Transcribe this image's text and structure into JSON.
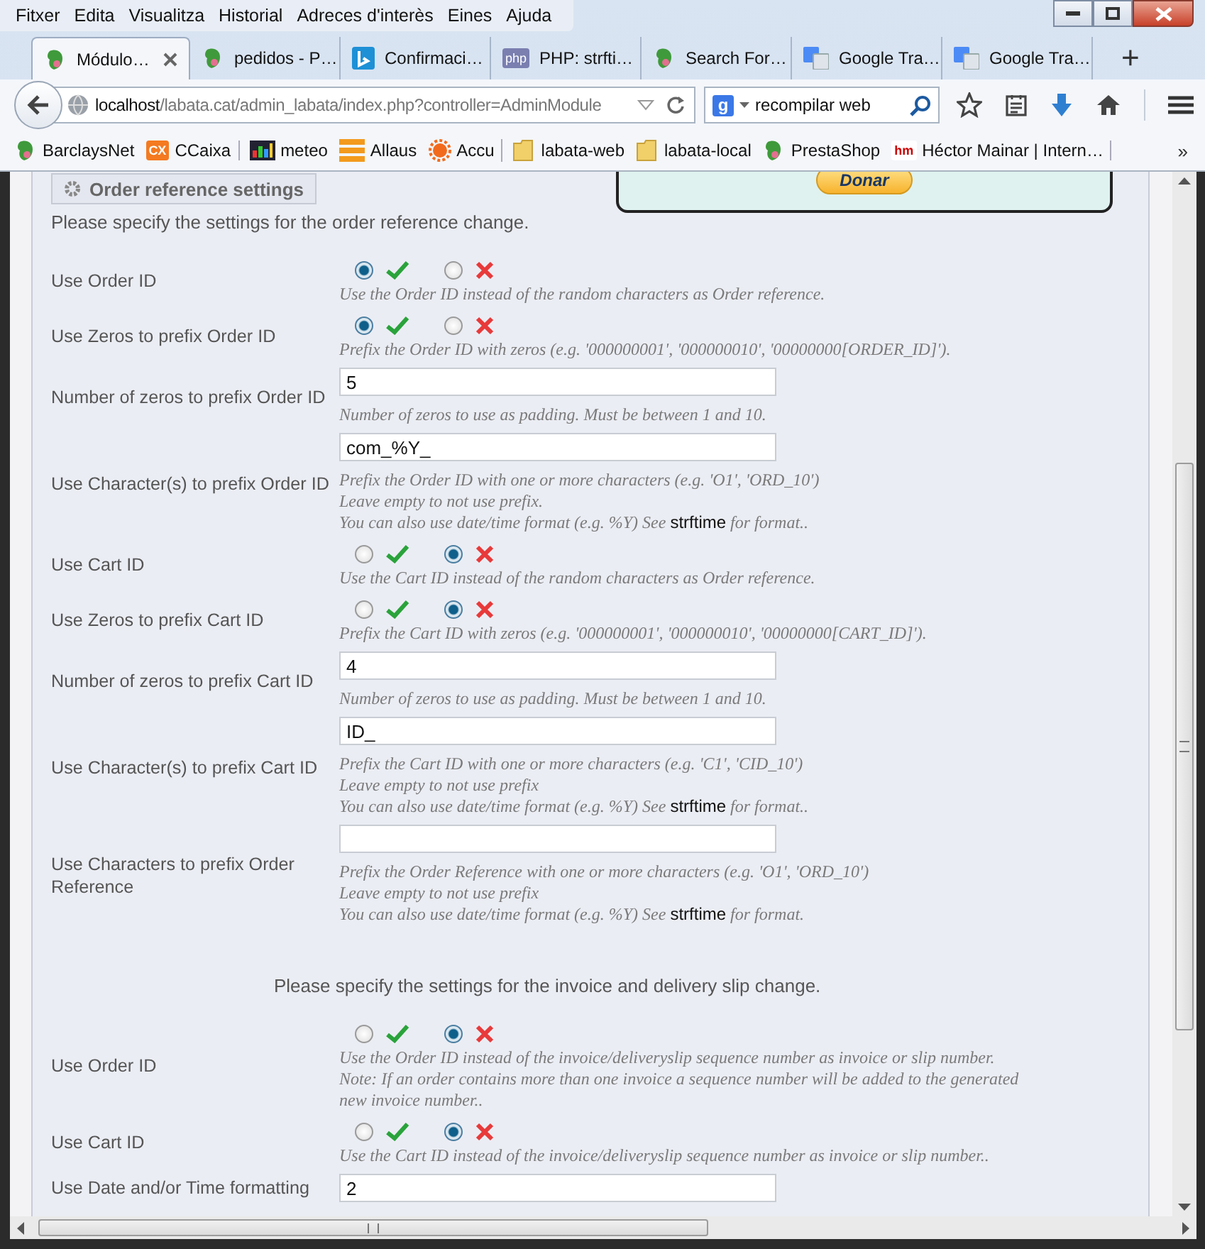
{
  "window": {
    "menu": [
      "Fitxer",
      "Edita",
      "Visualitza",
      "Historial",
      "Adreces d'interès",
      "Eines",
      "Ajuda"
    ]
  },
  "tabs": [
    {
      "title": "Módulo…",
      "kind": "bird",
      "selected": true
    },
    {
      "title": "pedidos - P…",
      "kind": "bird",
      "selected": false
    },
    {
      "title": "Confirmaci…",
      "kind": "square",
      "selected": false
    },
    {
      "title": "PHP: strfti…",
      "kind": "badge",
      "badge": "php",
      "selected": false
    },
    {
      "title": "Search For…",
      "kind": "bird",
      "selected": false
    },
    {
      "title": "Google Tra…",
      "kind": "translate",
      "selected": false
    },
    {
      "title": "Google Tra…",
      "kind": "translate",
      "selected": false
    }
  ],
  "new_tab": "+",
  "address_bar": {
    "host": "localhost",
    "path": "/labata.cat/admin_labata/index.php?controller=AdminModule"
  },
  "search": {
    "engine_badge": "g",
    "value": "recompilar web"
  },
  "bookmarks": [
    {
      "label": "BarclaysNet",
      "kind": "bird",
      "separator_after": false
    },
    {
      "label": "CCaixa",
      "kind": "badge",
      "badge": "CX",
      "separator_after": true
    },
    {
      "label": "meteo",
      "kind": "chart",
      "separator_after": false
    },
    {
      "label": "Allaus",
      "kind": "stripes",
      "separator_after": false
    },
    {
      "label": "Accu",
      "kind": "sun",
      "separator_after": true
    },
    {
      "label": "labata-web",
      "kind": "folder",
      "separator_after": false
    },
    {
      "label": "labata-local",
      "kind": "folder",
      "separator_after": false
    },
    {
      "label": "PrestaShop",
      "kind": "bird",
      "separator_after": false
    },
    {
      "label": "Héctor Mainar | Intern…",
      "kind": "badge",
      "badge": "hm",
      "separator_after": true
    }
  ],
  "bookmarks_overflow": "»",
  "donate": {
    "button": "Donar"
  },
  "section_1": {
    "legend": "Order reference settings",
    "intro": "Please specify the settings for the order reference change.",
    "rows": [
      {
        "label": "Use Order ID",
        "kind": "toggle",
        "enabled": true,
        "help": [
          "Use the Order ID instead of the random characters as Order reference."
        ]
      },
      {
        "label": "Use Zeros to prefix Order ID",
        "kind": "toggle",
        "enabled": true,
        "help": [
          "Prefix the Order ID with zeros (e.g. '000000001', '000000010', '00000000[ORDER_ID]')."
        ]
      },
      {
        "label": "Number of zeros to prefix Order ID",
        "kind": "text",
        "value": "5",
        "help": [
          "Number of zeros to use as padding. Must be between 1 and 10."
        ]
      },
      {
        "label": "Use Character(s) to prefix Order ID",
        "kind": "text",
        "value": "com_%Y_",
        "help": [
          "Prefix the Order ID with one or more characters (e.g. 'O1', 'ORD_10')",
          "Leave empty to not use prefix.",
          {
            "text": "You can also use date/time format (e.g. %Y) See ",
            "link": "strftime",
            "after": " for format.."
          }
        ]
      },
      {
        "label": "Use Cart ID",
        "kind": "toggle",
        "enabled": false,
        "help": [
          "Use the Cart ID instead of the random characters as Order reference."
        ]
      },
      {
        "label": "Use Zeros to prefix Cart ID",
        "kind": "toggle",
        "enabled": false,
        "help": [
          "Prefix the Cart ID with zeros (e.g. '000000001', '000000010', '00000000[CART_ID]')."
        ]
      },
      {
        "label": "Number of zeros to prefix Cart ID",
        "kind": "text",
        "value": "4",
        "help": [
          "Number of zeros to use as padding. Must be between 1 and 10."
        ]
      },
      {
        "label": "Use Character(s) to prefix Cart ID",
        "kind": "text",
        "value": "ID_",
        "help": [
          "Prefix the Cart ID with one or more characters (e.g. 'C1', 'CID_10')",
          "Leave empty to not use prefix",
          {
            "text": "You can also use date/time format (e.g. %Y) See ",
            "link": "strftime",
            "after": " for format.."
          }
        ]
      },
      {
        "label": "Use Characters to prefix Order Reference",
        "kind": "text",
        "value": "",
        "help": [
          "Prefix the Order Reference with one or more characters (e.g. 'O1', 'ORD_10')",
          "Leave empty to not use prefix",
          {
            "text": "You can also use date/time format (e.g. %Y) See ",
            "link": "strftime",
            "after": " for format."
          }
        ]
      }
    ]
  },
  "section_2": {
    "intro": "Please specify the settings for the invoice and delivery slip change.",
    "rows": [
      {
        "label": "Use Order ID",
        "kind": "toggle",
        "enabled": false,
        "help": [
          "Use the Order ID instead of the invoice/deliveryslip sequence number as invoice or slip number.",
          "Note: If an order contains more than one invoice a sequence number will be added to the generated new invoice number.."
        ]
      },
      {
        "label": "Use Cart ID",
        "kind": "toggle",
        "enabled": false,
        "help": [
          "Use the Cart ID instead of the invoice/deliveryslip sequence number as invoice or slip number.."
        ]
      },
      {
        "label": "Use Date and/or Time formatting",
        "kind": "text",
        "value": "2",
        "help": []
      }
    ]
  }
}
